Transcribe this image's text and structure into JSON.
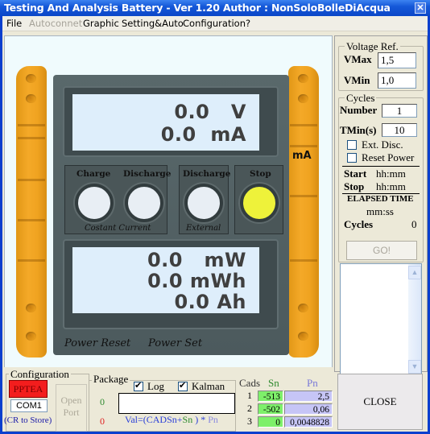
{
  "window": {
    "title": "Testing And Analysis Battery - Ver 1.20  Author : NonSoloBolleDiAcqua",
    "close_icon": "close-icon"
  },
  "menu": {
    "items": [
      {
        "label": "File",
        "enabled": true
      },
      {
        "label": "Autoconnet",
        "enabled": false
      },
      {
        "label": "Graphic",
        "enabled": true
      },
      {
        "label": "Setting&Auto",
        "enabled": true
      },
      {
        "label": "Configuration",
        "enabled": true
      },
      {
        "label": "?",
        "enabled": true
      }
    ]
  },
  "meter": {
    "display_top": {
      "voltage": "0.0   V",
      "current": "0.0  mA"
    },
    "side_unit": "mA",
    "buttons": {
      "charge": "Charge",
      "discharge_cc": "Discharge",
      "discharge_ext": "Discharge",
      "stop": "Stop"
    },
    "captions": {
      "constant_current": "Costant Current",
      "external": "External"
    },
    "display_bottom": {
      "power": "0.0   mW",
      "energy": "0.0 mWh",
      "capacity": "0.0 Ah"
    },
    "power_reset": "Power Reset",
    "power_set": "Power Set",
    "colors": {
      "stop_indicator": "#eef23a",
      "idle_indicator": "#e8eef4",
      "handle": "#f0a320"
    }
  },
  "voltage_ref": {
    "title": "Voltage Ref.",
    "vmax_label": "VMax",
    "vmax_value": "1,5",
    "vmin_label": "VMin",
    "vmin_value": "1,0"
  },
  "cycles": {
    "title": "Cycles",
    "number_label": "Number",
    "number_value": "1",
    "tmin_label": "TMin(s)",
    "tmin_value": "10",
    "ext_disc_label": "Ext. Disc.",
    "ext_disc_checked": false,
    "reset_power_label": "Reset Power",
    "reset_power_checked": false,
    "start_label": "Start",
    "start_value": "hh:mm",
    "stop_label": "Stop",
    "stop_value": "hh:mm",
    "elapsed_title": "ELAPSED TIME",
    "elapsed_value": "mm:ss",
    "cycles_label": "Cycles",
    "cycles_value": "0",
    "go_label": "GO!"
  },
  "configuration": {
    "title": "Configuration",
    "device": "PPTEA",
    "device_color": "#f31d1d",
    "port": "COM1",
    "hint": "(CR to Store)",
    "open_port_line1": "Open",
    "open_port_line2": "Port"
  },
  "package": {
    "title": "Package",
    "log_label": "Log",
    "log_checked": true,
    "kalman_label": "Kalman",
    "kalman_checked": true,
    "count_green": "0",
    "count_red": "0",
    "field_value": "",
    "formula_prefix": "Val=(CADSn+",
    "formula_sn": "Sn",
    "formula_mid": " ) * ",
    "formula_pn": "Pn"
  },
  "cads": {
    "header_cads": "Cads",
    "header_sn": "Sn",
    "header_pn": "Pn",
    "rows": [
      {
        "index": "1",
        "sn": "-513",
        "pn": "2,5"
      },
      {
        "index": "2",
        "sn": "-502",
        "pn": "0,06"
      },
      {
        "index": "3",
        "sn": "0",
        "pn": "0,0048828"
      }
    ]
  },
  "close_button": "CLOSE"
}
